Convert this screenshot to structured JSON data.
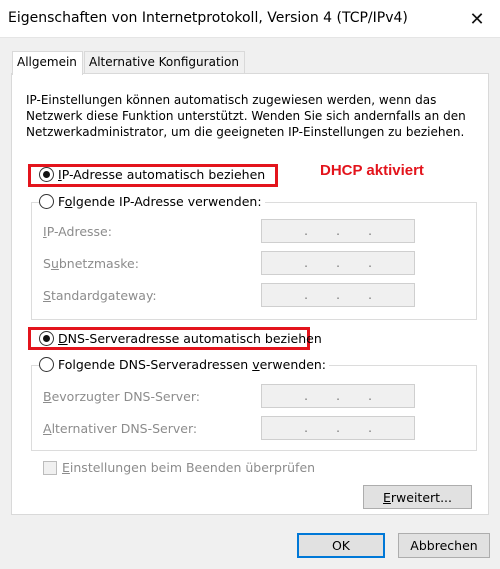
{
  "window": {
    "title": "Eigenschaften von Internetprotokoll, Version 4 (TCP/IPv4)",
    "close_glyph": "✕"
  },
  "tabs": [
    {
      "label": "Allgemein",
      "active": true
    },
    {
      "label": "Alternative Konfiguration",
      "active": false
    }
  ],
  "description": "IP-Einstellungen können automatisch zugewiesen werden, wenn das Netzwerk diese Funktion unterstützt. Wenden Sie sich andernfalls an den Netzwerkadministrator, um die geeigneten IP-Einstellungen zu beziehen.",
  "ip": {
    "auto_option": {
      "pre": "",
      "key": "I",
      "post": "P-Adresse automatisch beziehen",
      "checked": true
    },
    "manual_option": {
      "pre": "F",
      "key": "o",
      "post": "lgende IP-Adresse verwenden:",
      "checked": false
    },
    "fields": [
      {
        "pre": "",
        "key": "I",
        "post": "P-Adresse:",
        "dots": [
          ".",
          ".",
          "."
        ]
      },
      {
        "pre": "S",
        "key": "u",
        "post": "bnetzmaske:",
        "dots": [
          ".",
          ".",
          "."
        ]
      },
      {
        "pre": "",
        "key": "S",
        "post": "tandardgateway:",
        "dots": [
          ".",
          ".",
          "."
        ]
      }
    ]
  },
  "annotation": {
    "text": "DHCP aktiviert",
    "color": "#e3141c"
  },
  "dns": {
    "auto_option": {
      "pre": "",
      "key": "D",
      "post": "NS-Serveradresse automatisch beziehen",
      "checked": true
    },
    "manual_option": {
      "pre": "Folgende DNS-Serveradressen ",
      "key": "v",
      "post": "erwenden:",
      "checked": false
    },
    "fields": [
      {
        "pre": "",
        "key": "B",
        "post": "evorzugter DNS-Server:",
        "dots": [
          ".",
          ".",
          "."
        ]
      },
      {
        "pre": "",
        "key": "A",
        "post": "lternativer DNS-Server:",
        "dots": [
          ".",
          ".",
          "."
        ]
      }
    ]
  },
  "validate_checkbox": {
    "pre": "",
    "key": "E",
    "post": "instellungen beim Beenden überprüfen",
    "checked": false
  },
  "buttons": {
    "advanced": {
      "pre": "",
      "key": "E",
      "post": "rweitert..."
    },
    "ok": "OK",
    "cancel": "Abbrechen"
  },
  "colors": {
    "highlight": "#e3141c",
    "default_button_border": "#0078d7"
  }
}
